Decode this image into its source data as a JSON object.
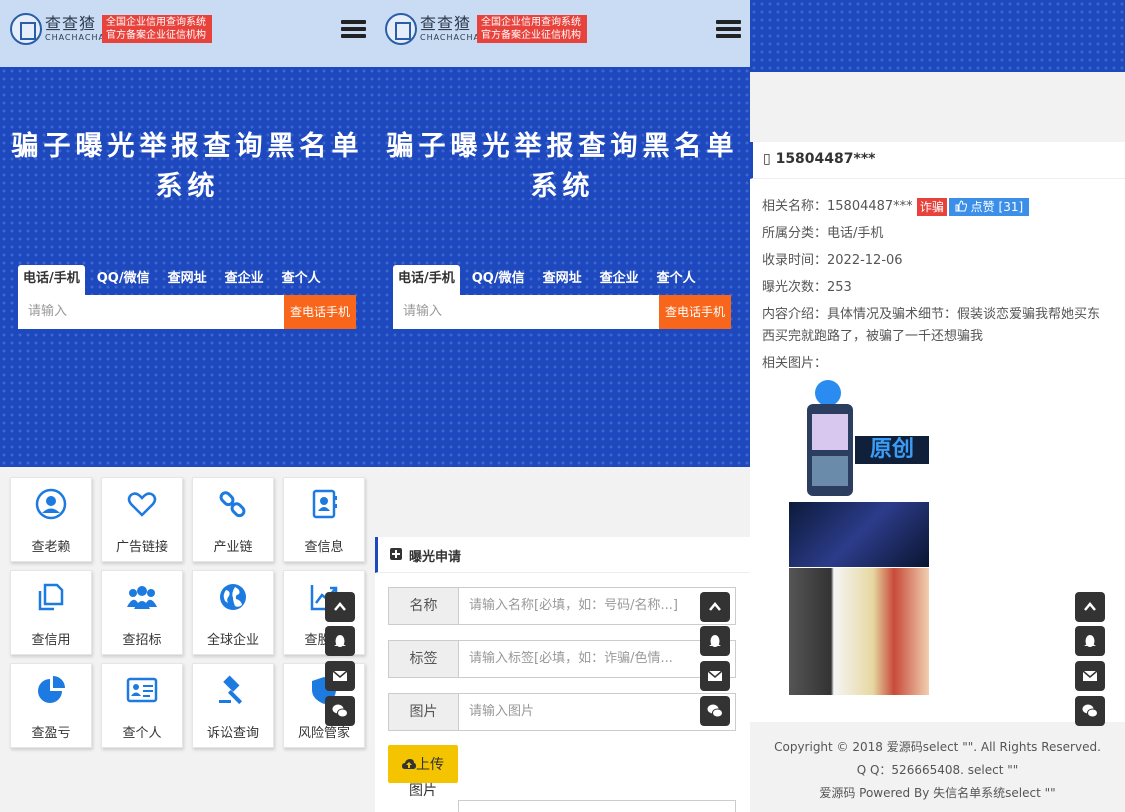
{
  "brand": {
    "name_cn": "查查猹",
    "name_en": "CHACHACHA",
    "tag_line1": "全国企业信用查询系统",
    "tag_line2": "官方备案企业征信机构"
  },
  "hero": {
    "title": "骗子曝光举报查询黑名单系统"
  },
  "search": {
    "tabs": [
      "电话/手机",
      "QQ/微信",
      "查网址",
      "查企业",
      "查个人"
    ],
    "placeholder": "请输入",
    "button": "查电话手机"
  },
  "grid": {
    "items": [
      {
        "label": "查老赖",
        "icon": "user-circle-icon"
      },
      {
        "label": "广告链接",
        "icon": "heart-icon"
      },
      {
        "label": "产业链",
        "icon": "chain-link-icon"
      },
      {
        "label": "查信息",
        "icon": "contact-book-icon"
      },
      {
        "label": "查信用",
        "icon": "copy-docs-icon"
      },
      {
        "label": "查招标",
        "icon": "group-users-icon"
      },
      {
        "label": "全球企业",
        "icon": "globe-icon"
      },
      {
        "label": "查股权",
        "icon": "trend-chart-icon"
      },
      {
        "label": "查盈亏",
        "icon": "pie-chart-icon"
      },
      {
        "label": "查个人",
        "icon": "id-card-icon"
      },
      {
        "label": "诉讼查询",
        "icon": "gavel-icon"
      },
      {
        "label": "风险管家",
        "icon": "shield-icon"
      }
    ]
  },
  "form": {
    "section_title": "曝光申请",
    "rows": [
      {
        "label": "名称",
        "placeholder": "请输入名称[必填，如：号码/名称...]"
      },
      {
        "label": "标签",
        "placeholder": "请输入标签[必填，如：诈骗/色情..."
      },
      {
        "label": "图片",
        "placeholder": "请输入图片"
      }
    ],
    "upload_label": "上传",
    "upload_sub": "图片"
  },
  "detail": {
    "header": "15804487***",
    "name_label": "相关名称：",
    "name_value": "15804487***",
    "tag": "诈骗",
    "like_label": "点赞",
    "like_count": "[31]",
    "category_label": "所属分类：",
    "category_value": "电话/手机",
    "time_label": "收录时间：",
    "time_value": "2022-12-06",
    "views_label": "曝光次数：",
    "views_value": "253",
    "desc_label": "内容介绍：",
    "desc_value": "具体情况及骗术细节：假装谈恋爱骗我帮她买东西买完就跑路了，被骗了一千还想骗我",
    "images_label": "相关图片：",
    "image_text": "原创"
  },
  "footer": {
    "line1": "Copyright © 2018 爱源码select \"\". All Rights Reserved.",
    "line2": "Q Q：526665408. select \"\"",
    "line3": "爱源码 Powered By 失信名单系统select \"\""
  },
  "fab_icons": [
    "chevron-up-icon",
    "qq-penguin-icon",
    "mail-icon",
    "wechat-icon"
  ],
  "colors": {
    "brand_blue": "#1e48be",
    "header_bg": "#c9dcf3",
    "accent_orange": "#f7661a",
    "icon_blue": "#1d7ae0",
    "tag_red": "#e8423c",
    "upload_yellow": "#f5c400"
  }
}
